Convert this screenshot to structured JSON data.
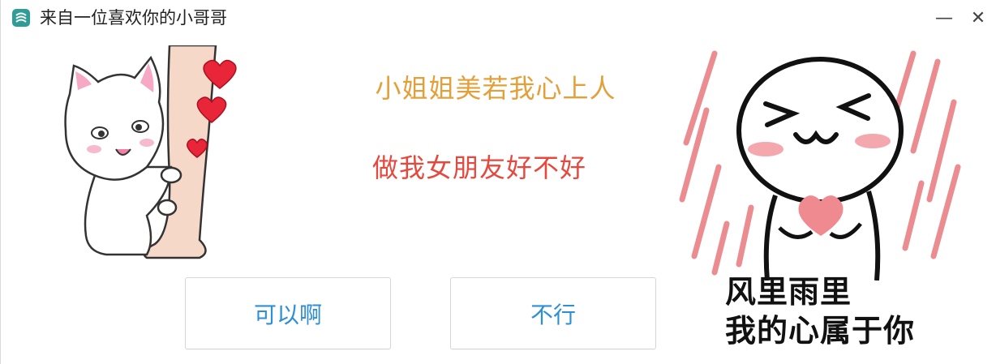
{
  "window": {
    "title": "来自一位喜欢你的小哥哥",
    "minimize_glyph": "—",
    "close_glyph": "✕"
  },
  "message": {
    "line1": "小姐姐美若我心上人",
    "line2": "做我女朋友好不好"
  },
  "buttons": {
    "yes_label": "可以啊",
    "no_label": "不行"
  },
  "meme": {
    "caption_line1": "风里雨里",
    "caption_line2": "我的心属于你"
  },
  "colors": {
    "line1": "#e3a03a",
    "line2": "#e6483e",
    "button_text": "#2e8fd6",
    "heart": "#e9253a",
    "meme_stripes": "#eb8c91"
  },
  "icons": {
    "app": "app-icon",
    "minimize": "minimize-icon",
    "close": "close-icon"
  }
}
